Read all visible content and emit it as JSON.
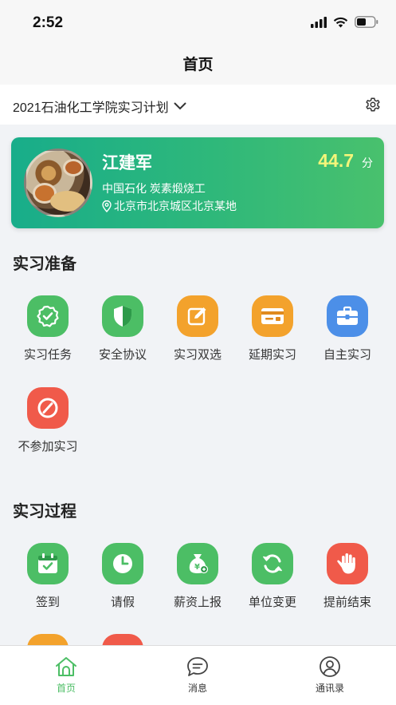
{
  "status": {
    "time": "2:52"
  },
  "nav": {
    "title": "首页"
  },
  "plan": {
    "title": "2021石油化工学院实习计划"
  },
  "profile": {
    "name": "江建军",
    "company": "中国石化 炭素煅烧工",
    "address": "北京市北京城区北京某地",
    "score": "44.7",
    "score_unit": "分"
  },
  "prep": {
    "title": "实习准备",
    "items": [
      {
        "label": "实习任务",
        "icon": "task-check-icon",
        "color": "#4cbe65"
      },
      {
        "label": "安全协议",
        "icon": "shield-icon",
        "color": "#4cbe65"
      },
      {
        "label": "实习双选",
        "icon": "edit-icon",
        "color": "#f3a22c"
      },
      {
        "label": "延期实习",
        "icon": "card-icon",
        "color": "#f3a22c"
      },
      {
        "label": "自主实习",
        "icon": "briefcase-icon",
        "color": "#4c8fe8"
      },
      {
        "label": "不参加实习",
        "icon": "forbid-icon",
        "color": "#f05a4a"
      }
    ]
  },
  "process": {
    "title": "实习过程",
    "items": [
      {
        "label": "签到",
        "icon": "calendar-check-icon",
        "color": "#4cbe65"
      },
      {
        "label": "请假",
        "icon": "clock-icon",
        "color": "#4cbe65"
      },
      {
        "label": "薪资上报",
        "icon": "money-bag-icon",
        "color": "#4cbe65"
      },
      {
        "label": "单位变更",
        "icon": "refresh-icon",
        "color": "#4cbe65"
      },
      {
        "label": "提前结束",
        "icon": "hand-stop-icon",
        "color": "#f05a4a"
      }
    ]
  },
  "tabs": [
    {
      "label": "首页",
      "active": true
    },
    {
      "label": "消息",
      "active": false
    },
    {
      "label": "通讯录",
      "active": false
    }
  ],
  "colors": {
    "brand_green": "#2fb87a",
    "score_yellow": "#f3f57a",
    "tab_active": "#4cbe65"
  }
}
